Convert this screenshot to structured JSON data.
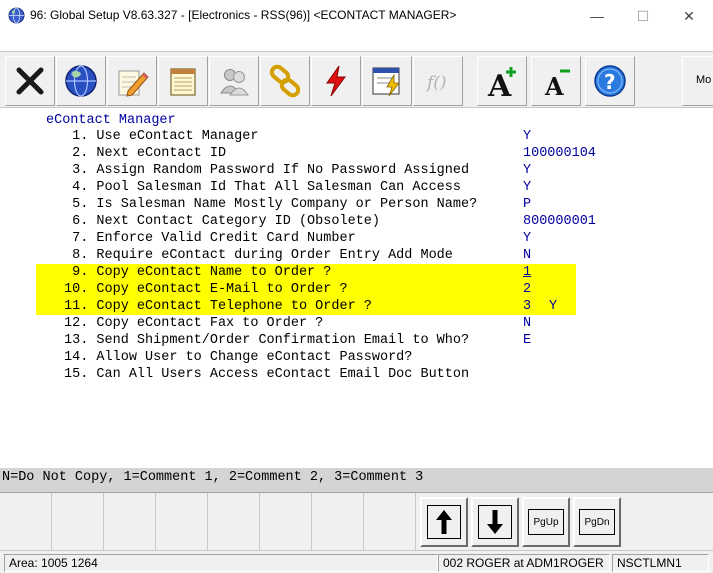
{
  "window": {
    "title": "96: Global Setup V8.63.327 - [Electronics - RSS(96)] <ECONTACT MANAGER>",
    "controls": {
      "minimize": "—",
      "maximize": "☐",
      "close": "✕"
    }
  },
  "toolbar": {
    "buttons": [
      {
        "icon": "close-x-icon"
      },
      {
        "icon": "globe-icon"
      },
      {
        "icon": "edit-pencil-icon"
      },
      {
        "icon": "notepad-icon"
      },
      {
        "icon": "users-icon"
      },
      {
        "icon": "chain-link-icon"
      },
      {
        "icon": "lightning-icon"
      },
      {
        "icon": "lightning-form-icon"
      },
      {
        "icon": "function-icon"
      },
      {
        "icon": "font-increase-icon"
      },
      {
        "icon": "font-decrease-icon"
      },
      {
        "icon": "help-icon"
      }
    ],
    "more_label": "Mo"
  },
  "main": {
    "section_title": "eContact Manager",
    "items": [
      {
        "num": " 1.",
        "label": "Use eContact Manager",
        "value": "Y"
      },
      {
        "num": " 2.",
        "label": "Next eContact ID",
        "value": "100000104"
      },
      {
        "num": " 3.",
        "label": "Assign Random Password If No Password Assigned",
        "value": "Y"
      },
      {
        "num": " 4.",
        "label": "Pool Salesman Id That All Salesman Can Access",
        "value": "Y"
      },
      {
        "num": " 5.",
        "label": "Is Salesman Name Mostly Company or Person Name?",
        "value": "P"
      },
      {
        "num": " 6.",
        "label": "Next Contact Category ID (Obsolete)",
        "value": "800000001"
      },
      {
        "num": " 7.",
        "label": "Enforce Valid Credit Card Number",
        "value": "Y"
      },
      {
        "num": " 8.",
        "label": "Require eContact during Order Entry Add Mode",
        "value": "N"
      },
      {
        "num": " 9.",
        "label": "Copy eContact Name to Order ?",
        "value": "1",
        "highlight": true
      },
      {
        "num": "10.",
        "label": "Copy eContact E-Mail to Order ?",
        "value": "2",
        "highlight": true
      },
      {
        "num": "11.",
        "label": "Copy eContact Telephone to Order ?",
        "value": "3",
        "extra": "Y",
        "highlight": true
      },
      {
        "num": "12.",
        "label": "Copy eContact Fax to Order ?",
        "value": "N"
      },
      {
        "num": "13.",
        "label": "Send Shipment/Order Confirmation Email to Who?",
        "value": "E"
      },
      {
        "num": "14.",
        "label": "Allow User to Change eContact Password?",
        "value": ""
      },
      {
        "num": "15.",
        "label": "Can All Users Access eContact Email Doc Button",
        "value": ""
      }
    ]
  },
  "hint": "N=Do Not Copy, 1=Comment 1, 2=Comment 2, 3=Comment 3",
  "nav_buttons": {
    "up": "up-arrow-icon",
    "down": "down-arrow-icon",
    "page_up": "PgUp",
    "page_down": "PgDn"
  },
  "status": {
    "area": "Area: 1005 1264",
    "user": "002 ROGER at ADM1ROGER",
    "program": "NSCTLMN1"
  }
}
